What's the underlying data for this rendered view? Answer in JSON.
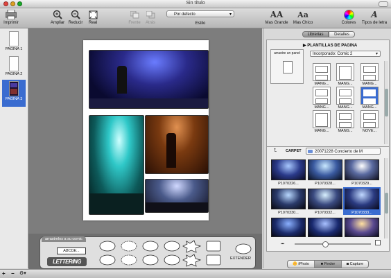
{
  "window": {
    "title": "Sin título"
  },
  "toolbar": {
    "print": "Imprimir",
    "zoom_in": "Ampliar",
    "zoom_out": "Reducir",
    "actual": "Real",
    "front": "Frente",
    "back": "Atrás",
    "style_label": "Estilo",
    "style_value": "Por defecto",
    "bigger": "Mas Grande",
    "smaller": "Mas Chico",
    "colors": "Colores",
    "fonts": "Tipos de letra",
    "big_glyph": "AA",
    "small_glyph": "Aa",
    "font_glyph": "A"
  },
  "pages": [
    {
      "label": "PAGINA 1"
    },
    {
      "label": "PAGINA 2"
    },
    {
      "label": "PAGINA 3",
      "selected": true
    }
  ],
  "balloons": {
    "tab": "arrastrelos a su comic",
    "caption_sample": "ABCDE...",
    "lettering": "LETTERING",
    "extend": "EXTENDER"
  },
  "right": {
    "tabs": [
      "Librerias",
      "Detalles"
    ],
    "templates_header": "PLANTILLAS DE PAGINA",
    "drag_panel": "arrastre un panel",
    "template_select": "Incorporado: Comic 2",
    "template_names": [
      "MANG...",
      "MANG...",
      "MANG...",
      "MANG...",
      "MANG...",
      "MANG...",
      "MANG...",
      "MANG...",
      "NOVE..."
    ],
    "carpet_label": "CARPET",
    "carpet_value": "20071228 Concierto de M",
    "photo_names": [
      "P1070326...",
      "P1070328...",
      "P1070329...",
      "P1070330...",
      "P1070332...",
      "P1070333..."
    ],
    "sources": [
      "iPhoto",
      "Finder",
      "Capture"
    ]
  },
  "colors": {
    "accent": "#3a6cd0",
    "canvas": "#7d7d7d"
  }
}
